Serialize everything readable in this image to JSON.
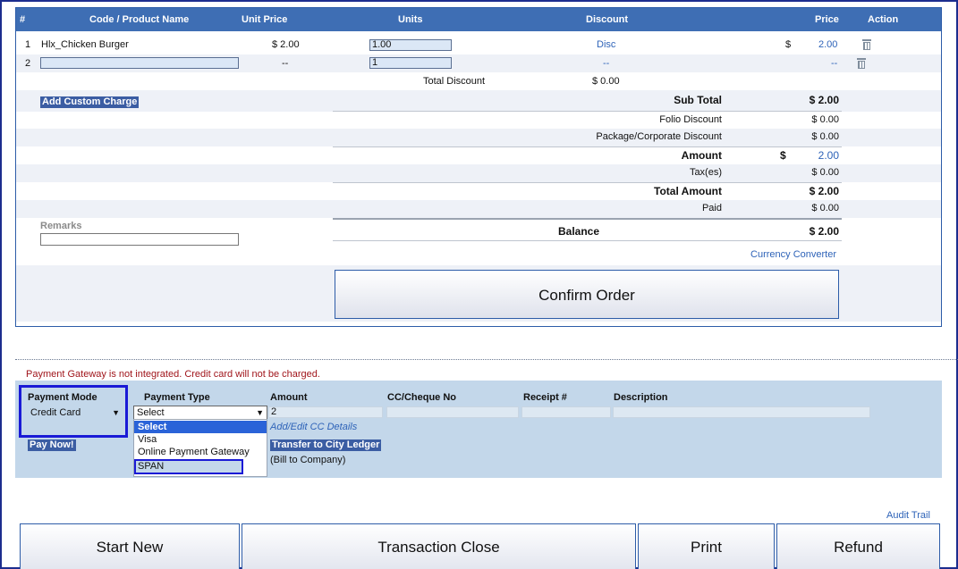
{
  "table": {
    "headers": [
      "#",
      "Code / Product Name",
      "Unit Price",
      "Units",
      "Discount",
      "Price",
      "Action"
    ],
    "rows": [
      {
        "num": "1",
        "product": "Hlx_Chicken Burger",
        "unit_price": "$ 2.00",
        "units": "1.00",
        "discount": "Disc",
        "currency": "$",
        "price": "2.00"
      },
      {
        "num": "2",
        "product": "",
        "unit_price": "--",
        "units": "1",
        "discount": "--",
        "currency": "",
        "price": "--"
      }
    ],
    "total_discount_label": "Total Discount",
    "total_discount_value": "$ 0.00",
    "add_custom_charge": "Add Custom Charge",
    "remarks_label": "Remarks"
  },
  "summary": {
    "sub_total_label": "Sub Total",
    "sub_total": "$ 2.00",
    "folio_discount_label": "Folio Discount",
    "folio_discount": "$ 0.00",
    "package_discount_label": "Package/Corporate Discount",
    "package_discount": "$ 0.00",
    "amount_label": "Amount",
    "amount_currency": "$",
    "amount": "2.00",
    "taxes_label": "Tax(es)",
    "taxes": "$ 0.00",
    "total_amount_label": "Total Amount",
    "total_amount": "$ 2.00",
    "paid_label": "Paid",
    "paid": "$ 0.00",
    "balance_label": "Balance",
    "balance": "$ 2.00",
    "currency_converter": "Currency Converter",
    "confirm_order": "Confirm Order"
  },
  "payment": {
    "warning": "Payment Gateway is not integrated. Credit card will not be charged.",
    "headers": {
      "mode": "Payment Mode",
      "type": "Payment Type",
      "amount": "Amount",
      "cc": "CC/Cheque No",
      "receipt": "Receipt #",
      "description": "Description"
    },
    "mode_value": "Credit Card",
    "type_value": "Select",
    "amount_value": "2",
    "type_options": [
      "Select",
      "Visa",
      "Online Payment Gateway",
      "SPAN"
    ],
    "add_edit_cc": "Add/Edit CC Details",
    "pay_now": "Pay Now!",
    "transfer_city_ledger": "Transfer to City Ledger",
    "bill_to_company": "(Bill to Company)"
  },
  "footer": {
    "audit_trail": "Audit Trail",
    "start_new": "Start New",
    "transaction_close": "Transaction Close",
    "print": "Print",
    "refund": "Refund"
  },
  "colors": {
    "header": "#3e6eb4",
    "link": "#2e63b8",
    "panel": "#c3d7ea",
    "warning": "#a0151b",
    "highlight_border": "#1a1ad6"
  }
}
